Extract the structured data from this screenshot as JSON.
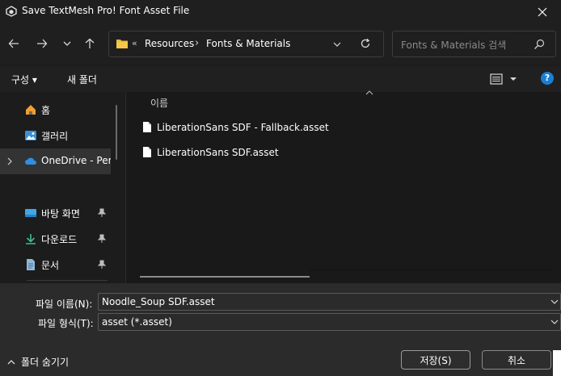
{
  "window": {
    "title": "Save TextMesh Pro! Font Asset File",
    "close_icon": "close-icon"
  },
  "nav": {
    "back_icon": "arrow-left-icon",
    "forward_icon": "arrow-right-icon",
    "recent_icon": "chevron-down-icon",
    "up_icon": "arrow-up-icon"
  },
  "address": {
    "overflow": "«",
    "crumbs": [
      "Resources",
      "Fonts & Materials"
    ],
    "separator": "›"
  },
  "search": {
    "placeholder": "Fonts & Materials 검색"
  },
  "commandbar": {
    "organize_label": "구성 ▾",
    "new_folder_label": "새 폴더",
    "help_label": "?"
  },
  "sidebar": {
    "items": [
      {
        "label": "홈",
        "icon": "home-icon"
      },
      {
        "label": "갤러리",
        "icon": "gallery-icon"
      },
      {
        "label": "OneDrive - Pers",
        "icon": "cloud-icon"
      },
      {
        "label": "바탕 화면",
        "icon": "desktop-icon"
      },
      {
        "label": "다운로드",
        "icon": "download-icon"
      },
      {
        "label": "문서",
        "icon": "document-icon"
      }
    ]
  },
  "content": {
    "column_name": "이름",
    "files": [
      {
        "name": "LiberationSans SDF - Fallback.asset"
      },
      {
        "name": "LiberationSans SDF.asset"
      }
    ]
  },
  "footer": {
    "filename_label": "파일 이름(N):",
    "filename_value": "Noodle_Soup SDF.asset",
    "filetype_label": "파일 형식(T):",
    "filetype_value": "asset (*.asset)",
    "hide_folders_label": "폴더 숨기기",
    "save_label": "저장(S)",
    "cancel_label": "취소"
  },
  "colors": {
    "accent": "#1a7fd4",
    "background": "#1c1c1c",
    "footer": "#2b2b2b"
  }
}
